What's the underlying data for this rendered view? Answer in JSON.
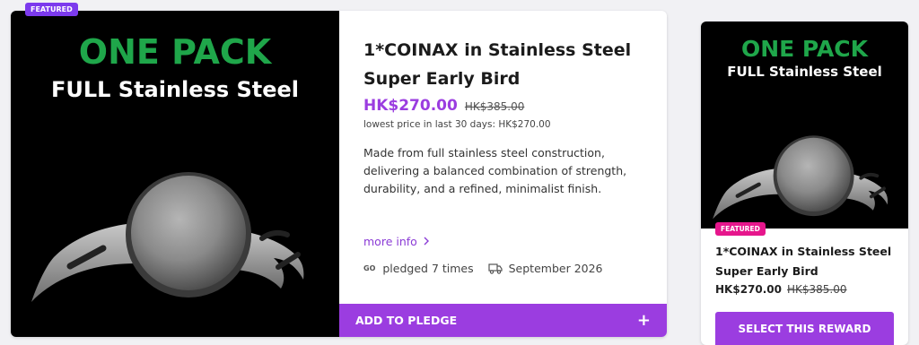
{
  "main_card": {
    "badge": "FEATURED",
    "image_heading": "ONE PACK",
    "image_subheading": "FULL Stainless Steel",
    "title": "1*COINAX in Stainless Steel Super Early Bird",
    "price_now": "HK$270.00",
    "price_old": "HK$385.00",
    "lowest_price": "lowest price in last 30 days:  HK$270.00",
    "description": "Made from full stainless steel construction, delivering a balanced combination of strength, durability, and a refined, minimalist finish.",
    "more_info": "more info",
    "pledge_icon_text": "GO",
    "pledged": "pledged 7 times",
    "delivery": "September 2026",
    "cta": "ADD TO PLEDGE",
    "cta_icon": "plus-icon"
  },
  "side_card": {
    "badge": "FEATURED",
    "image_heading": "ONE PACK",
    "image_subheading": "FULL Stainless Steel",
    "title": "1*COINAX in Stainless Steel Super Early Bird",
    "price_now": "HK$270.00",
    "price_old": "HK$385.00",
    "cta": "SELECT THIS REWARD"
  },
  "colors": {
    "accent": "#9b3de0",
    "badge_main": "#7c3aed",
    "badge_side": "#e6168c",
    "image_green": "#1fa64a"
  }
}
